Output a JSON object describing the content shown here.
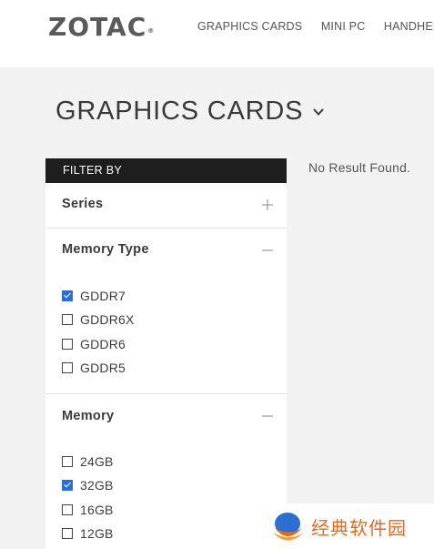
{
  "header": {
    "logo_text": "ZOTAC",
    "logo_mark": "®",
    "nav": [
      "GRAPHICS CARDS",
      "MINI PC",
      "HANDHELD"
    ]
  },
  "page": {
    "title": "GRAPHICS CARDS"
  },
  "filter": {
    "header": "FILTER BY",
    "sections": [
      {
        "title": "Series",
        "toggle": "plus",
        "options": []
      },
      {
        "title": "Memory Type",
        "toggle": "minus",
        "options": [
          {
            "label": "GDDR7",
            "checked": true
          },
          {
            "label": "GDDR6X",
            "checked": false
          },
          {
            "label": "GDDR6",
            "checked": false
          },
          {
            "label": "GDDR5",
            "checked": false
          }
        ]
      },
      {
        "title": "Memory",
        "toggle": "minus",
        "options": [
          {
            "label": "24GB",
            "checked": false
          },
          {
            "label": "32GB",
            "checked": true
          },
          {
            "label": "16GB",
            "checked": false
          },
          {
            "label": "12GB",
            "checked": false
          }
        ]
      }
    ]
  },
  "results": {
    "message": "No Result Found."
  },
  "watermark": {
    "text": "经典软件园"
  },
  "colors": {
    "filter_header_bg": "#1e1e1e",
    "checkbox_checked": "#2a6fd6",
    "watermark": "#e36a1d"
  }
}
